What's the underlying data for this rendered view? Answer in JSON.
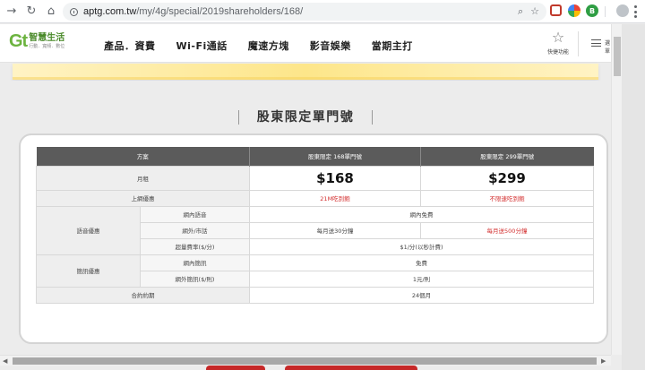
{
  "browser": {
    "url_host": "aptg.com.tw",
    "url_path": "/my/4g/special/2019shareholders/168/"
  },
  "header": {
    "logo_mark": "Gt",
    "logo_name": "智慧生活",
    "logo_sub": "行動．寬頻．數位",
    "nav": [
      "產品．資費",
      "Wi-Fi通話",
      "魔速方塊",
      "影音娛樂",
      "當期主打"
    ],
    "fav_label": "快捷功能",
    "menu_label": "選單"
  },
  "section": {
    "title": "股東限定單門號"
  },
  "table": {
    "headers": [
      "方案",
      "股東限定 168單門號",
      "股東限定 299單門號"
    ],
    "monthly_fee": {
      "label": "月租",
      "plan168": "$168",
      "plan299": "$299"
    },
    "data": {
      "label": "上網優惠",
      "plan168": "21M吃到飽",
      "plan299": "不限速吃到飽"
    },
    "voice": {
      "label": "語音優惠",
      "onnet_label": "網內語音",
      "onnet_value": "網內免費",
      "offnet_label": "網外/市話",
      "offnet_168": "每月送30分鐘",
      "offnet_299": "每月送500分鐘",
      "overage_label": "超量費率($/分)",
      "overage_value": "$1/分(以秒計費)"
    },
    "sms": {
      "label": "簡訊優惠",
      "onnet_label": "網內簡訊",
      "onnet_value": "免費",
      "offnet_label": "網外簡訊($/則)",
      "offnet_value": "1元/則"
    },
    "contract": {
      "label": "合約約期",
      "value": "24個月"
    }
  },
  "colors": {
    "brand_green": "#6cb33f",
    "header_gray": "#5b5b5b",
    "highlight_red": "#d32f2f"
  }
}
